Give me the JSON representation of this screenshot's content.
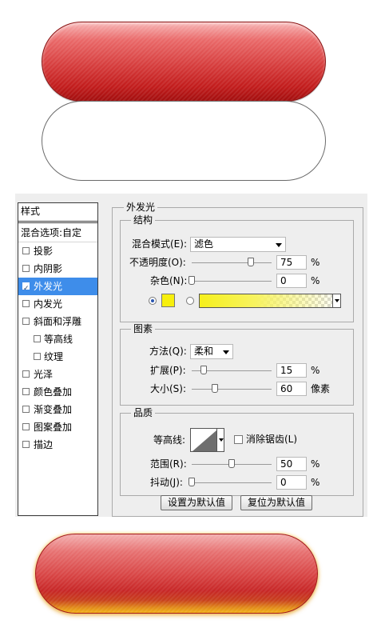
{
  "styles_panel": {
    "header": "样式",
    "blend_options": "混合选项:自定",
    "items": [
      {
        "label": "投影",
        "checked": false
      },
      {
        "label": "内阴影",
        "checked": false
      },
      {
        "label": "外发光",
        "checked": true,
        "selected": true
      },
      {
        "label": "内发光",
        "checked": false
      },
      {
        "label": "斜面和浮雕",
        "checked": false
      },
      {
        "label": "等高线",
        "checked": false,
        "sub": true
      },
      {
        "label": "纹理",
        "checked": false,
        "sub": true
      },
      {
        "label": "光泽",
        "checked": false
      },
      {
        "label": "颜色叠加",
        "checked": false
      },
      {
        "label": "渐变叠加",
        "checked": false
      },
      {
        "label": "图案叠加",
        "checked": false
      },
      {
        "label": "描边",
        "checked": false
      }
    ]
  },
  "outer_glow": {
    "title": "外发光",
    "structure": {
      "title": "结构",
      "blend_mode_label": "混合模式(E):",
      "blend_mode_value": "滤色",
      "opacity_label": "不透明度(O):",
      "opacity_value": "75",
      "opacity_unit": "%",
      "noise_label": "杂色(N):",
      "noise_value": "0",
      "noise_unit": "%",
      "color_swatch": "#f7ef0d",
      "color_mode": "solid"
    },
    "elements": {
      "title": "图素",
      "technique_label": "方法(Q):",
      "technique_value": "柔和",
      "spread_label": "扩展(P):",
      "spread_value": "15",
      "spread_unit": "%",
      "size_label": "大小(S):",
      "size_value": "60",
      "size_unit": "像素"
    },
    "quality": {
      "title": "品质",
      "contour_label": "等高线:",
      "anti_alias_label": "消除锯齿(L)",
      "anti_alias_checked": false,
      "range_label": "范围(R):",
      "range_value": "50",
      "range_unit": "%",
      "jitter_label": "抖动(J):",
      "jitter_value": "0",
      "jitter_unit": "%"
    },
    "buttons": {
      "make_default": "设置为默认值",
      "reset_default": "复位为默认值"
    }
  },
  "colors": {
    "pill_red": "#d63d3d",
    "glow_yellow": "#f3b317",
    "selection": "#3e8dea"
  }
}
